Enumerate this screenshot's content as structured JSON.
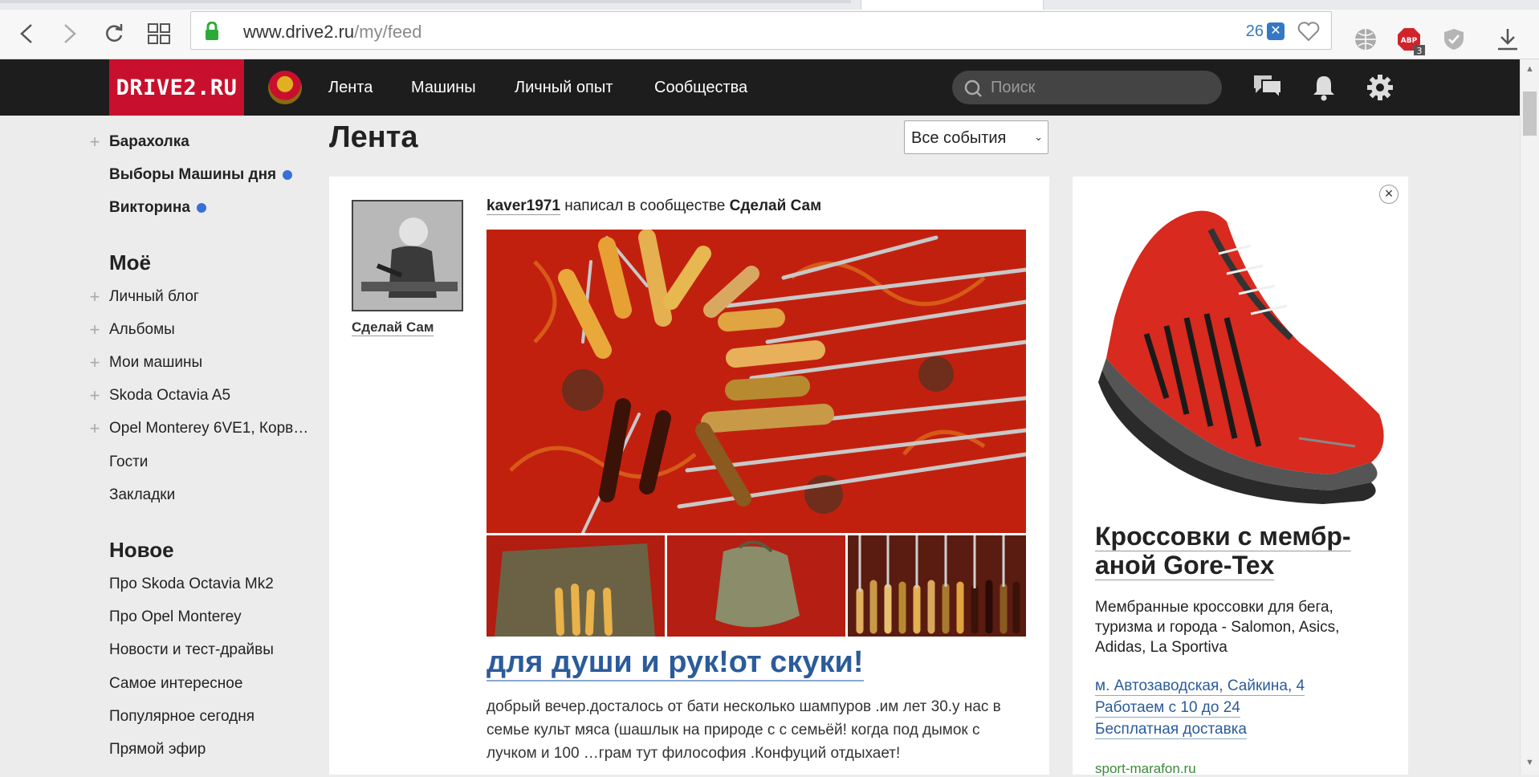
{
  "browser": {
    "url_host": "www.drive2.ru",
    "url_path": "/my/feed",
    "privacy_count": "26",
    "adblock_badge": "3",
    "adblock_label": "ABP"
  },
  "header": {
    "logo": "DRIVE2.RU",
    "menu": [
      "Лента",
      "Машины",
      "Личный опыт",
      "Сообщества"
    ],
    "search_placeholder": "Поиск"
  },
  "sidebar": {
    "top_items": [
      {
        "label": "Барахолка",
        "plus": true,
        "dot": false
      },
      {
        "label": "Выборы Машины дня",
        "plus": false,
        "dot": true
      },
      {
        "label": "Викторина",
        "plus": false,
        "dot": true
      }
    ],
    "mine_title": "Моё",
    "mine_items": [
      {
        "label": "Личный блог",
        "plus": true
      },
      {
        "label": "Альбомы",
        "plus": true
      },
      {
        "label": "Мои машины",
        "plus": true
      },
      {
        "label": "Skoda Octavia A5",
        "plus": true
      },
      {
        "label": "Opel Monterey 6VE1, Корв…",
        "plus": true
      },
      {
        "label": "Гости",
        "plus": false
      },
      {
        "label": "Закладки",
        "plus": false
      }
    ],
    "new_title": "Новое",
    "new_items": [
      "Про Skoda Octavia Mk2",
      "Про Opel Monterey",
      "Новости и тест-драйвы",
      "Самое интересное",
      "Популярное сегодня",
      "Прямой эфир"
    ]
  },
  "feed": {
    "title": "Лента",
    "filter_value": "Все события",
    "post": {
      "avatar_caption": "Сделай Сам",
      "author": "kaver1971",
      "action": "написал в сообществе",
      "community": "Сделай Сам",
      "title": "для души и рук!от скуки!",
      "text": "добрый вечер.досталось от бати несколько шампуров .им лет 30.у нас в семье культ мяса (шашлык на природе с с семьёй! когда под дымок с лучком и 100 …грам тут философия .Конфуций отдыхает!"
    }
  },
  "ad": {
    "title": "Кроссовки с мембр-аной Gore-Tex",
    "description": "Мембранные кроссовки для бега, туризма и города - Salomon, Asics, Adidas, La Sportiva",
    "links": [
      "м. Автозаводская, Сайкина, 4",
      "Работаем с 10 до 24",
      "Бесплатная доставка"
    ],
    "site": "sport-marafon.ru",
    "close_symbol": "×"
  }
}
